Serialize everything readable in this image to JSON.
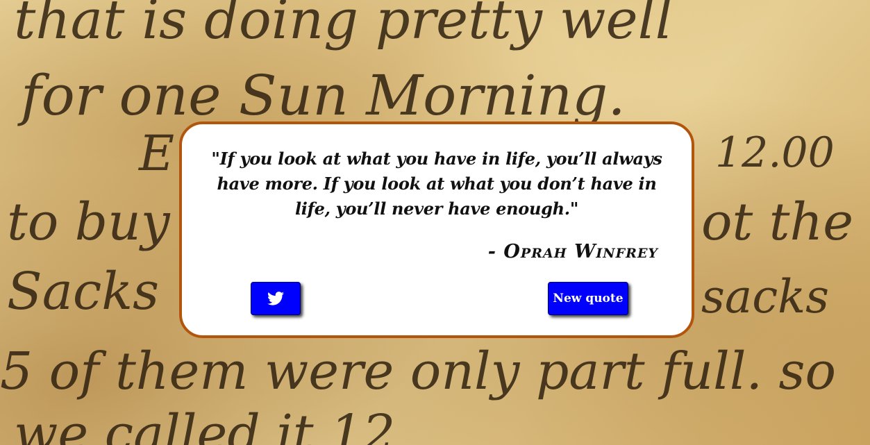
{
  "quote": {
    "text": "\"If you look at what you have in life, you’ll always have more. If you look at what you don’t have in life, you’ll never have enough.\"",
    "author": "- Oprah Winfrey"
  },
  "buttons": {
    "tweet_icon": "twitter-bird-icon",
    "new_quote_label": "New quote"
  },
  "colors": {
    "box_border": "#b3560d",
    "button_bg": "#0000ff",
    "button_text": "#ffffff"
  }
}
